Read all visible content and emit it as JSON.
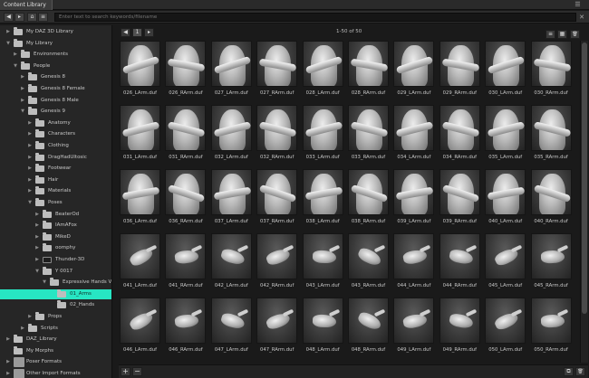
{
  "window": {
    "tab_title": "Content Library",
    "menu_icon": "menu-lines-icon"
  },
  "toolbar": {
    "back_icon": "◀",
    "forward_icon": "▸",
    "home_icon": "⌂",
    "filter_icon": "≡",
    "search_placeholder": "Enter text to search keywords/filename",
    "clear_icon": "✕"
  },
  "tree": [
    {
      "label": "My DAZ 3D Library",
      "depth": 0,
      "state": "collapsed"
    },
    {
      "label": "My Library",
      "depth": 0,
      "state": "expanded"
    },
    {
      "label": "Environments",
      "depth": 1,
      "state": "collapsed"
    },
    {
      "label": "People",
      "depth": 1,
      "state": "expanded"
    },
    {
      "label": "Genesis 8",
      "depth": 2,
      "state": "collapsed"
    },
    {
      "label": "Genesis 8 Female",
      "depth": 2,
      "state": "collapsed"
    },
    {
      "label": "Genesis 8 Male",
      "depth": 2,
      "state": "collapsed"
    },
    {
      "label": "Genesis 9",
      "depth": 2,
      "state": "expanded"
    },
    {
      "label": "Anatomy",
      "depth": 3,
      "state": "collapsed"
    },
    {
      "label": "Characters",
      "depth": 3,
      "state": "collapsed"
    },
    {
      "label": "Clothing",
      "depth": 3,
      "state": "collapsed"
    },
    {
      "label": "DragHadUltosic",
      "depth": 3,
      "state": "collapsed"
    },
    {
      "label": "Footwear",
      "depth": 3,
      "state": "collapsed"
    },
    {
      "label": "Hair",
      "depth": 3,
      "state": "collapsed"
    },
    {
      "label": "Materials",
      "depth": 3,
      "state": "collapsed"
    },
    {
      "label": "Poses",
      "depth": 3,
      "state": "expanded"
    },
    {
      "label": "BeaterOd",
      "depth": 4,
      "state": "collapsed"
    },
    {
      "label": "IAmAFox",
      "depth": 4,
      "state": "collapsed"
    },
    {
      "label": "MikeD",
      "depth": 4,
      "state": "collapsed"
    },
    {
      "label": "oomphy",
      "depth": 4,
      "state": "collapsed"
    },
    {
      "label": "Thunder-3D",
      "depth": 4,
      "state": "collapsed",
      "icon": "dark"
    },
    {
      "label": "Y 0017",
      "depth": 4,
      "state": "expanded"
    },
    {
      "label": "Expressive Hands Vol...",
      "depth": 5,
      "state": "expanded"
    },
    {
      "label": "01_Arms",
      "depth": 6,
      "state": "none",
      "selected": true
    },
    {
      "label": "02_Hands",
      "depth": 6,
      "state": "none"
    },
    {
      "label": "Props",
      "depth": 3,
      "state": "collapsed"
    },
    {
      "label": "Scripts",
      "depth": 2,
      "state": "collapsed"
    },
    {
      "label": "DAZ_Library",
      "depth": 0,
      "state": "collapsed"
    },
    {
      "label": "My Morphs",
      "depth": 0,
      "state": "none"
    },
    {
      "label": "Poser Formats",
      "depth": 0,
      "state": "collapsed",
      "icon": "big"
    },
    {
      "label": "Other Import Formats",
      "depth": 0,
      "state": "collapsed",
      "icon": "big"
    }
  ],
  "grid_header": {
    "prev_icon": "◀",
    "page": "1",
    "next_icon": "▸",
    "page_count": "1-50 of 50",
    "view_list_icon": "≡",
    "view_grid_icon": "▦",
    "trash_icon": "🗑"
  },
  "items": [
    {
      "label": "026_LArm.duf",
      "kind": "torso"
    },
    {
      "label": "026_RArm.duf",
      "kind": "torso"
    },
    {
      "label": "027_LArm.duf",
      "kind": "torso"
    },
    {
      "label": "027_RArm.duf",
      "kind": "torso"
    },
    {
      "label": "028_LArm.duf",
      "kind": "torso"
    },
    {
      "label": "028_RArm.duf",
      "kind": "torso"
    },
    {
      "label": "029_LArm.duf",
      "kind": "torso"
    },
    {
      "label": "029_RArm.duf",
      "kind": "torso"
    },
    {
      "label": "030_LArm.duf",
      "kind": "torso"
    },
    {
      "label": "030_RArm.duf",
      "kind": "torso"
    },
    {
      "label": "031_LArm.duf",
      "kind": "torso"
    },
    {
      "label": "031_RArm.duf",
      "kind": "torso"
    },
    {
      "label": "032_LArm.duf",
      "kind": "torso"
    },
    {
      "label": "032_RArm.duf",
      "kind": "torso"
    },
    {
      "label": "033_LArm.duf",
      "kind": "torso"
    },
    {
      "label": "033_RArm.duf",
      "kind": "torso"
    },
    {
      "label": "034_LArm.duf",
      "kind": "torso"
    },
    {
      "label": "034_RArm.duf",
      "kind": "torso"
    },
    {
      "label": "035_LArm.duf",
      "kind": "torso"
    },
    {
      "label": "035_RArm.duf",
      "kind": "torso"
    },
    {
      "label": "036_LArm.duf",
      "kind": "torso"
    },
    {
      "label": "036_RArm.duf",
      "kind": "torso"
    },
    {
      "label": "037_LArm.duf",
      "kind": "torso"
    },
    {
      "label": "037_RArm.duf",
      "kind": "torso"
    },
    {
      "label": "038_LArm.duf",
      "kind": "torso"
    },
    {
      "label": "038_RArm.duf",
      "kind": "torso"
    },
    {
      "label": "039_LArm.duf",
      "kind": "torso"
    },
    {
      "label": "039_RArm.duf",
      "kind": "torso"
    },
    {
      "label": "040_LArm.duf",
      "kind": "torso"
    },
    {
      "label": "040_RArm.duf",
      "kind": "torso"
    },
    {
      "label": "041_LArm.duf",
      "kind": "hand"
    },
    {
      "label": "041_RArm.duf",
      "kind": "hand"
    },
    {
      "label": "042_LArm.duf",
      "kind": "hand"
    },
    {
      "label": "042_RArm.duf",
      "kind": "hand"
    },
    {
      "label": "043_LArm.duf",
      "kind": "hand"
    },
    {
      "label": "043_RArm.duf",
      "kind": "hand"
    },
    {
      "label": "044_LArm.duf",
      "kind": "hand"
    },
    {
      "label": "044_RArm.duf",
      "kind": "hand"
    },
    {
      "label": "045_LArm.duf",
      "kind": "hand"
    },
    {
      "label": "045_RArm.duf",
      "kind": "hand"
    },
    {
      "label": "046_LArm.duf",
      "kind": "hand"
    },
    {
      "label": "046_RArm.duf",
      "kind": "hand"
    },
    {
      "label": "047_LArm.duf",
      "kind": "hand"
    },
    {
      "label": "047_RArm.duf",
      "kind": "hand"
    },
    {
      "label": "048_LArm.duf",
      "kind": "hand"
    },
    {
      "label": "048_RArm.duf",
      "kind": "hand"
    },
    {
      "label": "049_LArm.duf",
      "kind": "hand"
    },
    {
      "label": "049_RArm.duf",
      "kind": "hand"
    },
    {
      "label": "050_LArm.duf",
      "kind": "hand"
    },
    {
      "label": "050_RArm.duf",
      "kind": "hand"
    }
  ],
  "footer": {
    "add_icon": "+",
    "remove_icon": "−",
    "copy_icon": "⧉",
    "trash_icon": "🗑"
  }
}
